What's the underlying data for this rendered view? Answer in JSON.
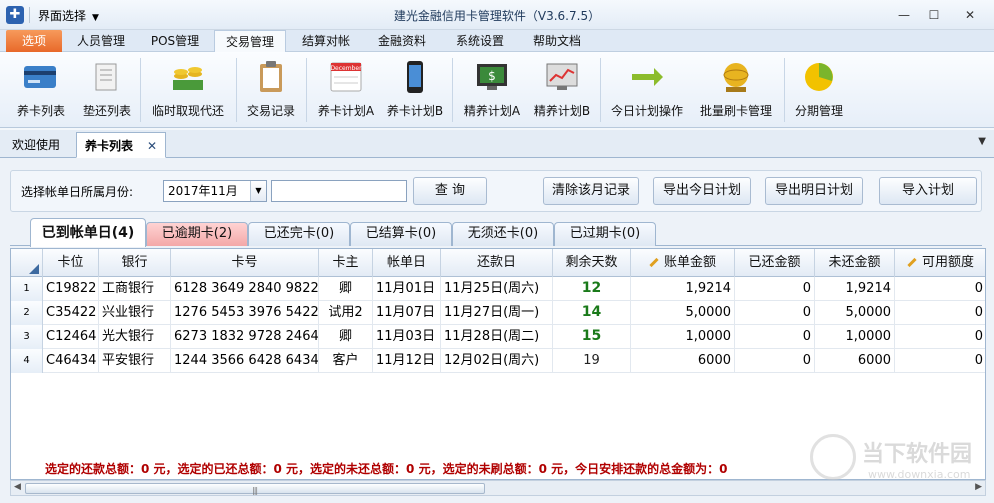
{
  "window": {
    "ui_select": "界面选择",
    "title": "建光金融信用卡管理软件（V3.6.7.5）",
    "min": "—",
    "max": "☐",
    "close": "✕"
  },
  "menu": [
    "选项",
    "人员管理",
    "POS管理",
    "交易管理",
    "结算对帐",
    "金融资料",
    "系统设置",
    "帮助文档"
  ],
  "ribbon": [
    "养卡列表",
    "垫还列表",
    "临时取现代还",
    "交易记录",
    "养卡计划A",
    "养卡计划B",
    "精养计划A",
    "精养计划B",
    "今日计划操作",
    "批量刷卡管理",
    "分期管理"
  ],
  "ribbon_calendar_text": "December",
  "doc_tabs": [
    "欢迎使用",
    "养卡列表"
  ],
  "filter": {
    "label": "选择帐单日所属月份:",
    "month": "2017年11月",
    "search_btn": "查 询",
    "buttons": [
      "清除该月记录",
      "导出今日计划",
      "导出明日计划",
      "导入计划"
    ]
  },
  "sub_tabs": [
    "已到帐单日(4)",
    "已逾期卡(2)",
    "已还完卡(0)",
    "已结算卡(0)",
    "无须还卡(0)",
    "已过期卡(0)"
  ],
  "columns": [
    "卡位",
    "银行",
    "卡号",
    "卡主",
    "帐单日",
    "还款日",
    "剩余天数",
    "账单金额",
    "已还金额",
    "未还金额",
    "可用额度"
  ],
  "rows": [
    {
      "n": "1",
      "slot": "C19822",
      "bank": "工商银行",
      "card": "6128 3649 2840 9822",
      "owner": "卿",
      "bill": "11月01日",
      "due": "11月25日(周六)",
      "days": "12",
      "amount": "1,9214",
      "paid": "0",
      "unpaid": "1,9214",
      "avail": "0"
    },
    {
      "n": "2",
      "slot": "C35422",
      "bank": "兴业银行",
      "card": "1276 5453 3976 5422",
      "owner": "试用2",
      "bill": "11月07日",
      "due": "11月27日(周一)",
      "days": "14",
      "amount": "5,0000",
      "paid": "0",
      "unpaid": "5,0000",
      "avail": "0"
    },
    {
      "n": "3",
      "slot": "C12464",
      "bank": "光大银行",
      "card": "6273 1832 9728 2464",
      "owner": "卿",
      "bill": "11月03日",
      "due": "11月28日(周二)",
      "days": "15",
      "amount": "1,0000",
      "paid": "0",
      "unpaid": "1,0000",
      "avail": "0"
    },
    {
      "n": "4",
      "slot": "C46434",
      "bank": "平安银行",
      "card": "1244 3566 6428 6434",
      "owner": "客户",
      "bill": "11月12日",
      "due": "12月02日(周六)",
      "days": "19",
      "amount": "6000",
      "paid": "0",
      "unpaid": "6000",
      "avail": "0"
    }
  ],
  "status": "选定的还款总额：0 元，选定的已还总额：0 元，选定的未还总额：0 元，选定的未刷总额：0 元，今日安排还款的总金额为：0",
  "watermark": {
    "name": "当下软件园",
    "url": "www.downxia.com"
  },
  "colors": {
    "accent_orange": "#e8692a",
    "overdue_tab": "#f3a8a8",
    "days_green": "#1a7a1a",
    "status_red": "#b00000"
  }
}
